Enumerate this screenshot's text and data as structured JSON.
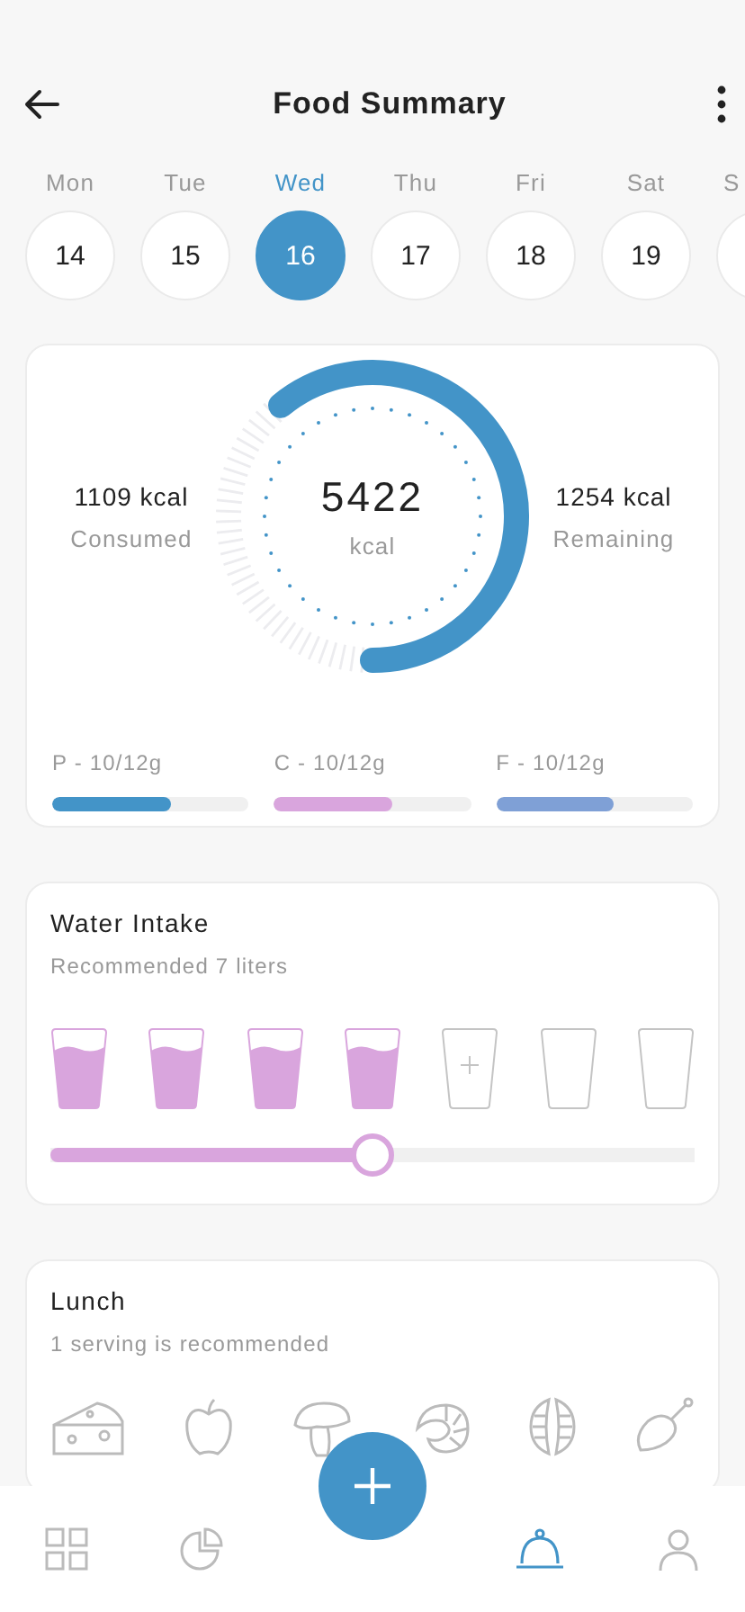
{
  "header": {
    "title": "Food Summary"
  },
  "days": [
    {
      "label": "Mon",
      "date": "14",
      "selected": false
    },
    {
      "label": "Tue",
      "date": "15",
      "selected": false
    },
    {
      "label": "Wed",
      "date": "16",
      "selected": true
    },
    {
      "label": "Thu",
      "date": "17",
      "selected": false
    },
    {
      "label": "Fri",
      "date": "18",
      "selected": false
    },
    {
      "label": "Sat",
      "date": "19",
      "selected": false
    },
    {
      "label": "S",
      "selected": false
    }
  ],
  "calories": {
    "consumed_value": "1109 kcal",
    "consumed_label": "Consumed",
    "total": "5422",
    "unit": "kcal",
    "remaining_value": "1254 kcal",
    "remaining_label": "Remaining"
  },
  "macros": [
    {
      "label": "P - 10/12g",
      "level": 0.6,
      "color": "#4394c8"
    },
    {
      "label": "C - 10/12g",
      "level": 0.6,
      "color": "#d9a5dd"
    },
    {
      "label": "F - 10/12g",
      "level": 0.6,
      "color": "#7fa0d6"
    }
  ],
  "water": {
    "title": "Water Intake",
    "subtitle": "Recommended 7 liters",
    "glasses": [
      {
        "kind": "filled"
      },
      {
        "kind": "filled"
      },
      {
        "kind": "filled"
      },
      {
        "kind": "filled"
      },
      {
        "kind": "add"
      },
      {
        "kind": "empty"
      },
      {
        "kind": "empty"
      }
    ],
    "level": 0.5
  },
  "lunch": {
    "title": "Lunch",
    "subtitle": "1 serving is recommended",
    "foods": [
      {
        "kind": "cheese"
      },
      {
        "kind": "apple"
      },
      {
        "kind": "mushroom"
      },
      {
        "kind": "shrimp"
      },
      {
        "kind": "nut"
      },
      {
        "kind": "drumstick"
      }
    ]
  },
  "nav": [
    {
      "kind": "grid",
      "selected": false
    },
    {
      "kind": "pie",
      "selected": false
    },
    {
      "kind": "add"
    },
    {
      "kind": "cloche",
      "selected": true
    },
    {
      "kind": "person",
      "selected": false
    }
  ]
}
